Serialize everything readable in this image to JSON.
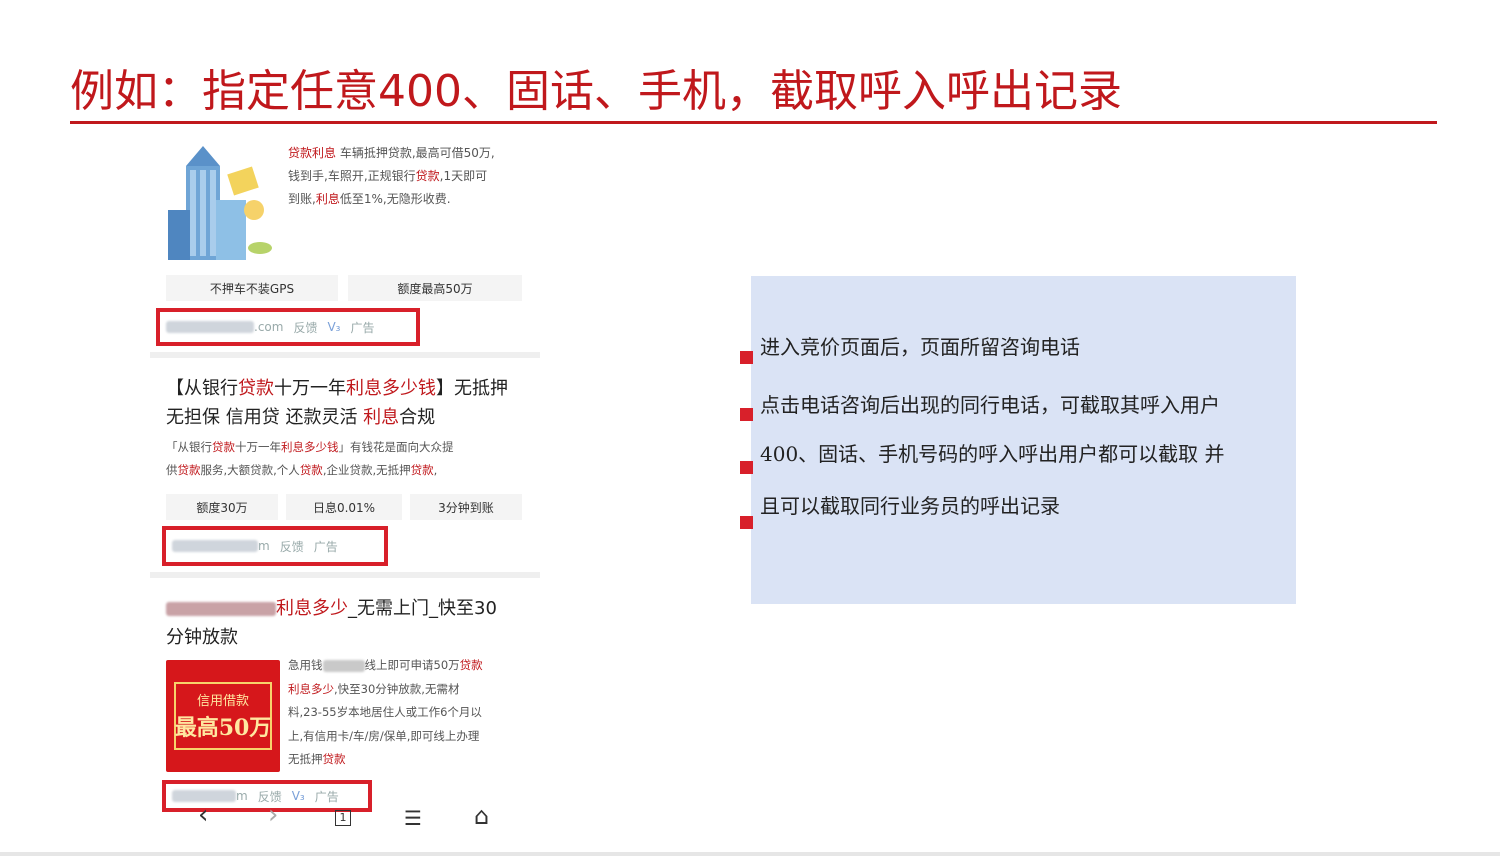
{
  "title": "例如：指定任意400、固话、手机，截取呼入呼出记录",
  "phone": {
    "ad1": {
      "line1_pre": "贷款利息",
      "line1_rest": " 车辆抵押贷款,最高可借50万,",
      "line2_a": "钱到手,车照开,正规银行",
      "line2_red": "贷款",
      "line2_b": ",1天即可",
      "line3_a": "到账,",
      "line3_red": "利息",
      "line3_b": "低至1%,无隐形收费.",
      "tags": [
        "不押车不装GPS",
        "额度最高50万"
      ],
      "url_suffix": ".com",
      "feedback": "反馈",
      "v": "V₃",
      "ad_label": "广告"
    },
    "ad2": {
      "title_line1_a": "【从银行",
      "title_line1_red1": "贷款",
      "title_line1_b": "十万一年",
      "title_line1_red2": "利息多少钱",
      "title_line1_c": "】无抵押",
      "title_line2_a": "无担保 信用贷 还款灵活 ",
      "title_line2_red": "利息",
      "title_line2_b": "合规",
      "desc_line1_a": "「从银行",
      "desc_line1_red1": "贷款",
      "desc_line1_b": "十万一年",
      "desc_line1_red2": "利息多少钱",
      "desc_line1_c": "」有钱花是面向大众提",
      "desc_line2_a": "供",
      "desc_line2_red1": "贷款",
      "desc_line2_b": "服务,大额贷款,个人",
      "desc_line2_red2": "贷款",
      "desc_line2_c": ",企业贷款,无抵押",
      "desc_line2_red3": "贷款",
      "desc_line2_d": ",",
      "tags": [
        "额度30万",
        "日息0.01%",
        "3分钟到账"
      ],
      "url_suffix": "m",
      "feedback": "反馈",
      "ad_label": "广告"
    },
    "ad3": {
      "title_line1_red": "利息多少",
      "title_line1_b": "_无需上门_快至30",
      "title_line2": "分钟放款",
      "desc_line1_a": "急用钱",
      "desc_line1_b": "线上即可申请50万",
      "desc_line1_red": "贷款",
      "desc_line2_red": "利息多少",
      "desc_line2_b": ",快至30分钟放款,无需材",
      "desc_line3": "料,23-55岁本地居住人或工作6个月以",
      "desc_line4": "上,有信用卡/车/房/保单,即可线上办理",
      "desc_line5_a": "无抵押",
      "desc_line5_red": "贷款",
      "promo_small": "信用借款",
      "promo_big": "最高50万",
      "url_suffix": "m",
      "feedback": "反馈",
      "v": "V₃",
      "ad_label": "广告"
    },
    "nav": {
      "back": "‹",
      "forward": "›",
      "tabs": "1",
      "menu": "☰",
      "home": "⌂"
    }
  },
  "info": {
    "lines": [
      "进入竞价页面后，页面所留咨询电话",
      "点击电话咨询后出现的同行电话，可截取其呼入用户",
      "400、固话、手机号码的呼入呼出用户都可以截取  并",
      "且可以截取同行业务员的呼出记录"
    ]
  },
  "colors": {
    "accent_red": "#c0181c",
    "panel_blue": "#dae3f5",
    "box_red": "#d8202a"
  }
}
